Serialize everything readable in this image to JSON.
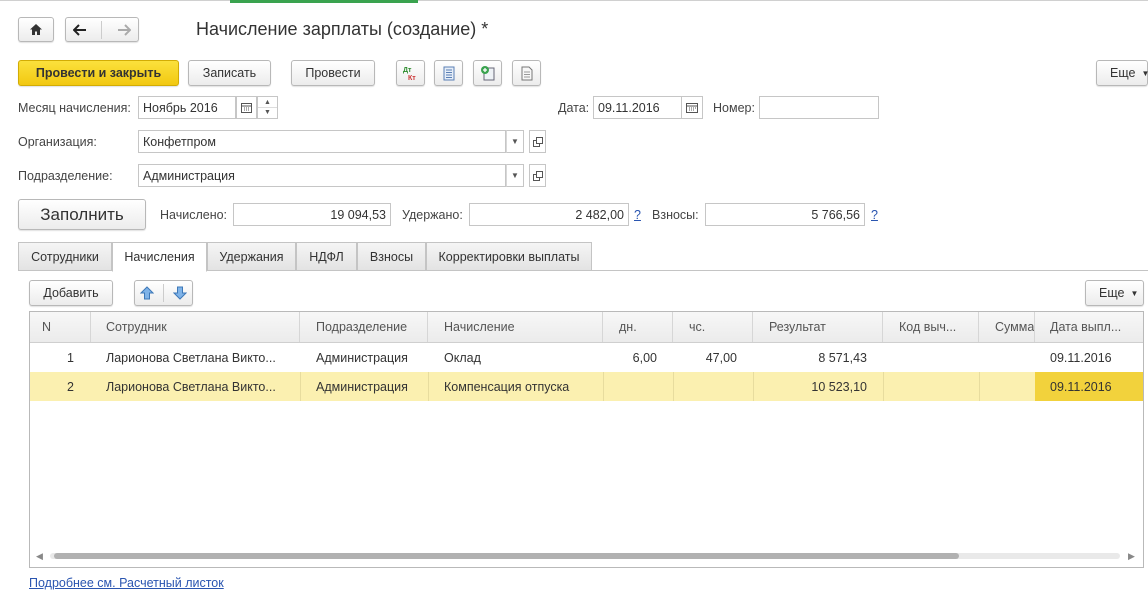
{
  "window": {
    "title": "Начисление зарплаты (создание) *"
  },
  "nav": {
    "home_icon": "home-icon",
    "back_icon": "arrow-left-icon",
    "forward_icon": "arrow-right-icon"
  },
  "toolbar": {
    "post_close_label": "Провести и закрыть",
    "save_label": "Записать",
    "post_label": "Провести",
    "more_label": "Еще"
  },
  "form": {
    "month_label": "Месяц начисления:",
    "month_value": "Ноябрь 2016",
    "date_label": "Дата:",
    "date_value": "09.11.2016",
    "number_label": "Номер:",
    "number_value": "",
    "org_label": "Организация:",
    "org_value": "Конфетпром",
    "dept_label": "Подразделение:",
    "dept_value": "Администрация"
  },
  "totals": {
    "fill_label": "Заполнить",
    "accrued_label": "Начислено:",
    "accrued_value": "19 094,53",
    "withheld_label": "Удержано:",
    "withheld_value": "2 482,00",
    "contrib_label": "Взносы:",
    "contrib_value": "5 766,56",
    "help_mark": "?"
  },
  "tabs": [
    {
      "label": "Сотрудники"
    },
    {
      "label": "Начисления"
    },
    {
      "label": "Удержания"
    },
    {
      "label": "НДФЛ"
    },
    {
      "label": "Взносы"
    },
    {
      "label": "Корректировки выплаты"
    }
  ],
  "table_toolbar": {
    "add_label": "Добавить",
    "more_label": "Еще"
  },
  "table": {
    "columns": [
      "N",
      "Сотрудник",
      "Подразделение",
      "Начисление",
      "дн.",
      "чс.",
      "Результат",
      "Код выч...",
      "Сумма ...",
      "Дата выпл..."
    ],
    "rows": [
      {
        "n": "1",
        "employee": "Ларионова Светлана Викто...",
        "dept": "Администрация",
        "accrual": "Оклад",
        "days": "6,00",
        "hours": "47,00",
        "result": "8 571,43",
        "code": "",
        "sum": "",
        "date": "09.11.2016"
      },
      {
        "n": "2",
        "employee": "Ларионова Светлана Викто...",
        "dept": "Администрация",
        "accrual": "Компенсация отпуска",
        "days": "",
        "hours": "",
        "result": "10 523,10",
        "code": "",
        "sum": "",
        "date": "09.11.2016"
      }
    ]
  },
  "footer": {
    "link_label": "Подробнее см. Расчетный листок"
  },
  "colors": {
    "accent_yellow": "#f2c811",
    "selection": "#fbf0b0",
    "link": "#2a55b0",
    "tab_active_indicator": "#3aa34f"
  }
}
